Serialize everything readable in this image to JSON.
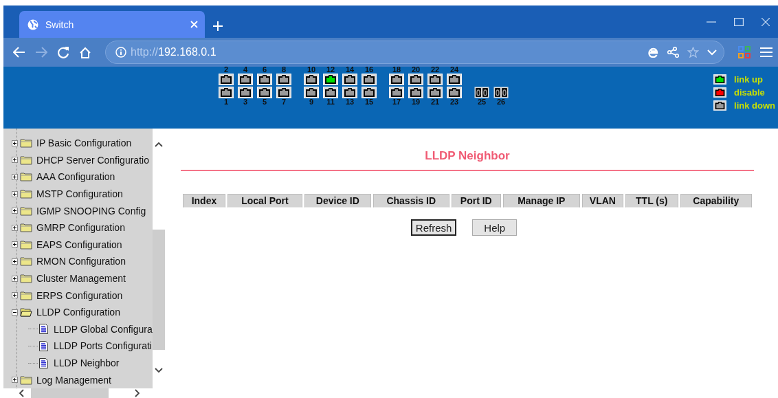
{
  "browser": {
    "tab_title": "Switch",
    "url_scheme": "http://",
    "url_host": "192.168.0.1"
  },
  "port_groups": [
    {
      "upper": [
        {
          "label": "2",
          "link_up": false
        },
        {
          "label": "4",
          "link_up": false
        },
        {
          "label": "6",
          "link_up": false
        },
        {
          "label": "8",
          "link_up": false
        }
      ],
      "lower": [
        {
          "label": "1",
          "link_up": false,
          "kind": "copper"
        },
        {
          "label": "3",
          "link_up": false,
          "kind": "copper"
        },
        {
          "label": "5",
          "link_up": false,
          "kind": "copper"
        },
        {
          "label": "7",
          "link_up": false,
          "kind": "copper"
        }
      ]
    },
    {
      "upper": [
        {
          "label": "10",
          "link_up": false
        },
        {
          "label": "12",
          "link_up": true
        },
        {
          "label": "14",
          "link_up": false
        },
        {
          "label": "16",
          "link_up": false
        }
      ],
      "lower": [
        {
          "label": "9",
          "link_up": false,
          "kind": "copper"
        },
        {
          "label": "11",
          "link_up": false,
          "kind": "copper"
        },
        {
          "label": "13",
          "link_up": false,
          "kind": "copper"
        },
        {
          "label": "15",
          "link_up": false,
          "kind": "copper"
        }
      ]
    },
    {
      "upper": [
        {
          "label": "18",
          "link_up": false
        },
        {
          "label": "20",
          "link_up": false
        },
        {
          "label": "22",
          "link_up": false
        },
        {
          "label": "24",
          "link_up": false
        }
      ],
      "lower": [
        {
          "label": "17",
          "link_up": false,
          "kind": "copper"
        },
        {
          "label": "19",
          "link_up": false,
          "kind": "copper"
        },
        {
          "label": "21",
          "link_up": false,
          "kind": "copper"
        },
        {
          "label": "23",
          "link_up": false,
          "kind": "copper"
        }
      ]
    },
    {
      "lower": [
        {
          "label": "25",
          "link_up": false,
          "kind": "fiber"
        },
        {
          "label": "26",
          "link_up": false,
          "kind": "fiber"
        }
      ]
    }
  ],
  "legend": [
    {
      "label": "link up",
      "link_up": true,
      "disabled": false
    },
    {
      "label": "disable",
      "disabled": true
    },
    {
      "label": "link down",
      "link_up": false,
      "disabled": false
    }
  ],
  "nav_tree": [
    {
      "label": "IP Basic Configuration",
      "expanded": false
    },
    {
      "label": "DHCP Server Configuratio",
      "expanded": false
    },
    {
      "label": "AAA Configuration",
      "expanded": false
    },
    {
      "label": "MSTP Configuration",
      "expanded": false
    },
    {
      "label": "IGMP SNOOPING Config",
      "expanded": false
    },
    {
      "label": "GMRP Configuration",
      "expanded": false
    },
    {
      "label": "EAPS Configuration",
      "expanded": false
    },
    {
      "label": "RMON Configuration",
      "expanded": false
    },
    {
      "label": "Cluster Management",
      "expanded": false
    },
    {
      "label": "ERPS Configuration",
      "expanded": false
    },
    {
      "label": "LLDP Configuration",
      "expanded": true,
      "children": [
        {
          "label": "LLDP Global Configura"
        },
        {
          "label": "LLDP Ports Configurati"
        },
        {
          "label": "LLDP Neighbor"
        }
      ]
    },
    {
      "label": "Log Management",
      "expanded": false
    }
  ],
  "page": {
    "title": "LLDP Neighbor",
    "table": {
      "columns": [
        "Index",
        "Local Port",
        "Device ID",
        "Chassis ID",
        "Port ID",
        "Manage IP",
        "VLAN",
        "TTL (s)",
        "Capability"
      ]
    },
    "buttons": [
      {
        "label": "Refresh",
        "focused": true
      },
      {
        "label": "Help",
        "focused": false
      }
    ]
  }
}
